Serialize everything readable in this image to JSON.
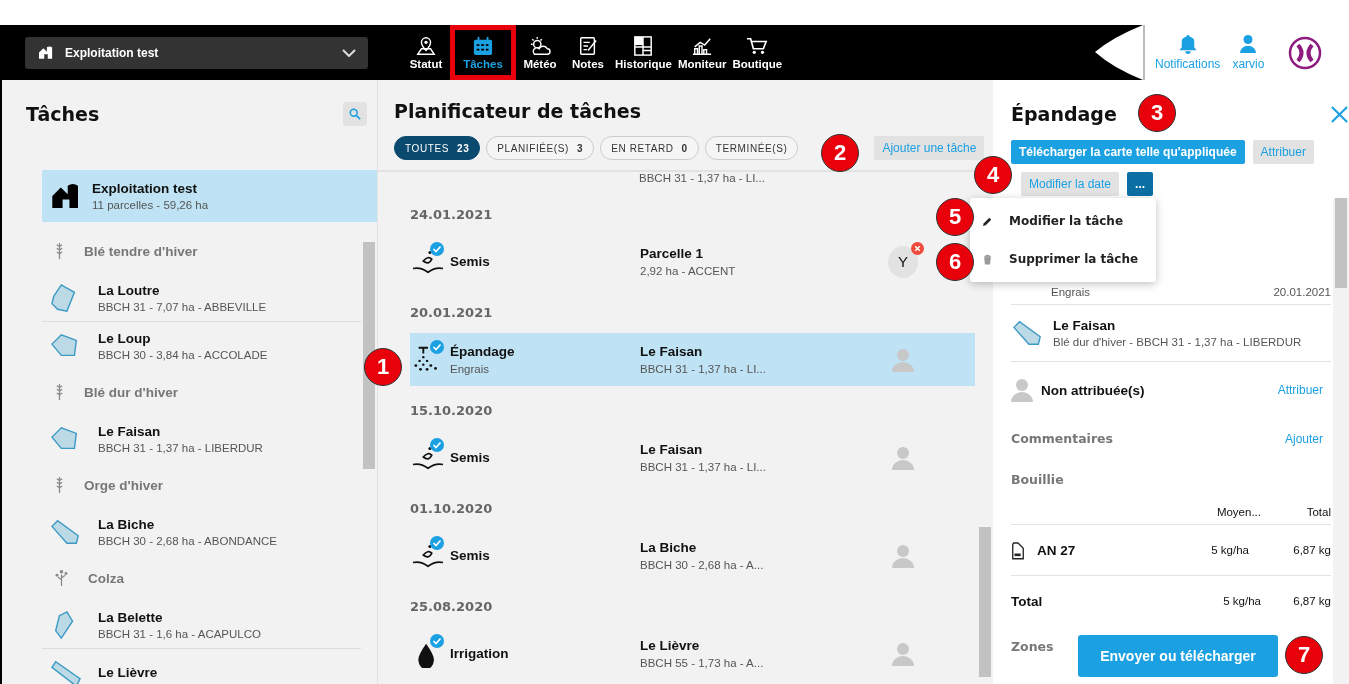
{
  "top_bar": {
    "farm_selector": "Exploitation test",
    "nav": [
      {
        "label": "Statut",
        "selected": false,
        "annotated": false
      },
      {
        "label": "Tâches",
        "selected": true,
        "annotated": true
      },
      {
        "label": "Météo",
        "selected": false,
        "annotated": false
      },
      {
        "label": "Notes",
        "selected": false,
        "annotated": false
      },
      {
        "label": "Historique",
        "selected": false,
        "annotated": false
      },
      {
        "label": "Moniteur",
        "selected": false,
        "annotated": false
      },
      {
        "label": "Boutique",
        "selected": false,
        "annotated": false
      }
    ],
    "notifications": "Notifications",
    "user": "xarvio"
  },
  "tasks_panel": {
    "title": "Tâches",
    "farm": {
      "name": "Exploitation test",
      "summary": "11 parcelles - 59,26 ha",
      "selected": true
    },
    "crops": [
      {
        "name": "Blé tendre d'hiver",
        "kind": "cereal",
        "children": [
          {
            "name": "La Loutre",
            "details": "BBCH 31 - 7,07 ha - ABBEVILLE"
          },
          {
            "name": "Le Loup",
            "details": "BBCH 30 - 3,84 ha - ACCOLADE"
          }
        ]
      },
      {
        "name": "Blé dur d'hiver",
        "kind": "cereal",
        "children": [
          {
            "name": "Le Faisan",
            "details": "BBCH 31 - 1,37 ha - LIBERDUR"
          }
        ]
      },
      {
        "name": "Orge d'hiver",
        "kind": "cereal",
        "children": [
          {
            "name": "La Biche",
            "details": "BBCH 30 - 2,68 ha - ABONDANCE"
          }
        ]
      },
      {
        "name": "Colza",
        "kind": "rapeseed",
        "children": [
          {
            "name": "La Belette",
            "details": "BBCH 31 - 1,6 ha - ACAPULCO"
          },
          {
            "name": "Le Lièvre"
          }
        ]
      }
    ]
  },
  "planner": {
    "title": "Planificateur de tâches",
    "filters": [
      {
        "label": "TOUTES",
        "count": "23",
        "selected": true
      },
      {
        "label": "PLANIFIÉE(S)",
        "count": "3",
        "selected": false
      },
      {
        "label": "EN RETARD",
        "count": "0",
        "selected": false
      },
      {
        "label": "TERMINÉE(S)",
        "selected": false
      }
    ],
    "add_button": "Ajouter une tâche",
    "partial_row_details": "BBCH 31 - 1,37 ha - LI...",
    "groups": [
      {
        "date": "24.01.2021",
        "tasks": [
          {
            "kind": "seeding",
            "name": "Semis",
            "field": "Parcelle 1",
            "details": "2,92 ha - ACCENT",
            "assignee": "Y",
            "assignee_warning": true,
            "completed": true,
            "selected": false
          }
        ]
      },
      {
        "date": "20.01.2021",
        "tasks": [
          {
            "kind": "spreading",
            "name": "Épandage",
            "subtitle": "Engrais",
            "field": "Le Faisan",
            "details": "BBCH 31 - 1,37 ha - LI...",
            "assignee_warning": false,
            "completed": true,
            "selected": true
          }
        ]
      },
      {
        "date": "15.10.2020",
        "tasks": [
          {
            "kind": "seeding",
            "name": "Semis",
            "field": "Le Faisan",
            "details": "BBCH 31 - 1,37 ha - LI...",
            "assignee_warning": false,
            "completed": true,
            "selected": false
          }
        ]
      },
      {
        "date": "01.10.2020",
        "tasks": [
          {
            "kind": "seeding",
            "name": "Semis",
            "field": "La Biche",
            "details": "BBCH 30 - 2,68 ha - A...",
            "assignee_warning": false,
            "completed": true,
            "selected": false
          }
        ]
      },
      {
        "date": "25.08.2020",
        "tasks": [
          {
            "kind": "irrigation",
            "name": "Irrigation",
            "field": "Le Lièvre",
            "details": "BBCH 55 - 1,73 ha - A...",
            "assignee_warning": false,
            "completed": true,
            "selected": false
          }
        ]
      }
    ]
  },
  "detail": {
    "title": "Épandage",
    "actions": [
      {
        "label": "Télécharger la carte telle qu'appliquée",
        "kind": "primary"
      },
      {
        "label": "Attribuer",
        "kind": "secondary"
      },
      {
        "label": "Modifier la date",
        "kind": "secondary"
      },
      {
        "label": "...",
        "kind": "more"
      }
    ],
    "menu": [
      {
        "label": "Modifier la tâche",
        "kind": "edit"
      },
      {
        "label": "Supprimer la tâche",
        "kind": "delete"
      }
    ],
    "summary": {
      "subtitle": "Engrais",
      "date": "20.01.2021"
    },
    "field": {
      "name": "Le Faisan",
      "details": "Blé dur d'hiver - BBCH 31 - 1,37 ha - LIBERDUR"
    },
    "assignee": {
      "label": "Non attribuée(s)",
      "action": "Attribuer"
    },
    "comments": {
      "title": "Commentaires",
      "action": "Ajouter"
    },
    "mix": {
      "title": "Bouillie",
      "columns": [
        "Moyen...",
        "Total"
      ],
      "rows": [
        {
          "name": "AN 27",
          "average": "5 kg/ha",
          "total": "6,87 kg"
        }
      ],
      "total": {
        "label": "Total",
        "average": "5 kg/ha",
        "total": "6,87 kg"
      }
    },
    "zones_title": "Zones",
    "send_button": "Envoyer ou télécharger"
  },
  "callouts": [
    "1",
    "2",
    "3",
    "4",
    "5",
    "6",
    "7"
  ]
}
